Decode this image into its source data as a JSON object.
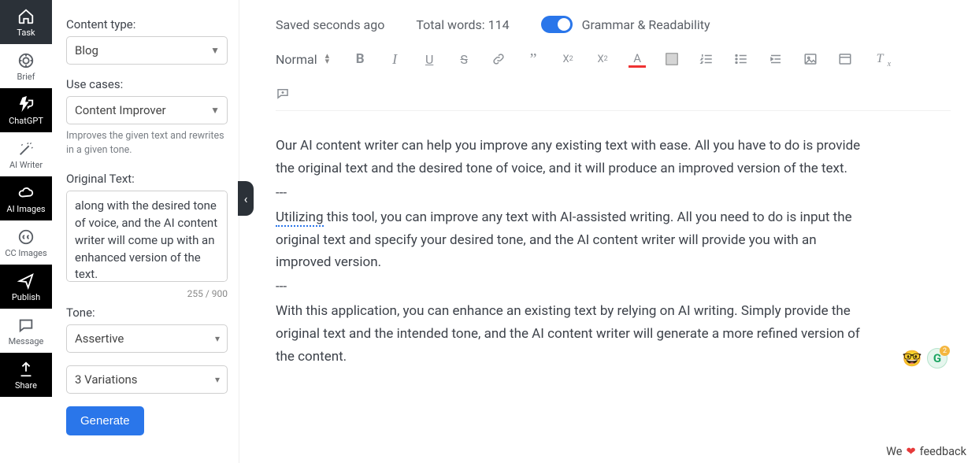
{
  "rail": {
    "items": [
      {
        "label": "Task",
        "icon": "home"
      },
      {
        "label": "Brief",
        "icon": "target"
      },
      {
        "label": "ChatGPT",
        "icon": "bolt-chat"
      },
      {
        "label": "AI Writer",
        "icon": "wand"
      },
      {
        "label": "AI Images",
        "icon": "cloud-image"
      },
      {
        "label": "CC Images",
        "icon": "cc"
      },
      {
        "label": "Publish",
        "icon": "send"
      },
      {
        "label": "Message",
        "icon": "chat"
      },
      {
        "label": "Share",
        "icon": "upload"
      }
    ]
  },
  "panel": {
    "content_type_label": "Content type:",
    "content_type_value": "Blog",
    "use_cases_label": "Use cases:",
    "use_cases_value": "Content Improver",
    "use_cases_helper": "Improves the given text and rewrites in a given tone.",
    "original_text_label": "Original Text:",
    "original_text_value": "along with the desired tone of voice, and the AI content writer will come up with an enhanced version of the text.",
    "counter": "255 / 900",
    "tone_label": "Tone:",
    "tone_value": "Assertive",
    "variations_value": "3 Variations",
    "generate_label": "Generate"
  },
  "topbar": {
    "saved": "Saved seconds ago",
    "words": "Total words: 114",
    "grammar_label": "Grammar & Readability",
    "toggle_on": true
  },
  "toolbar": {
    "format_label": "Normal"
  },
  "doc": {
    "p1": "Our AI content writer can help you improve any existing text with ease. All you have to do is provide the original text and the desired tone of voice, and it will produce an improved version of the text.",
    "sep": "---",
    "p2_pre": "Utilizing",
    "p2_rest": " this tool, you can improve any text with AI-assisted writing. All you need to do is input the original text and specify your desired tone, and the AI content writer will provide you with an improved version.",
    "p3": "With this application, you can enhance an existing text by relying on AI writing. Simply provide the original text and the intended tone, and the AI content writer will generate a more refined version of the content."
  },
  "float": {
    "emoji": "🤓",
    "grammarly": "G",
    "badge": "2"
  },
  "feedback": {
    "pre": "We",
    "post": "feedback"
  }
}
